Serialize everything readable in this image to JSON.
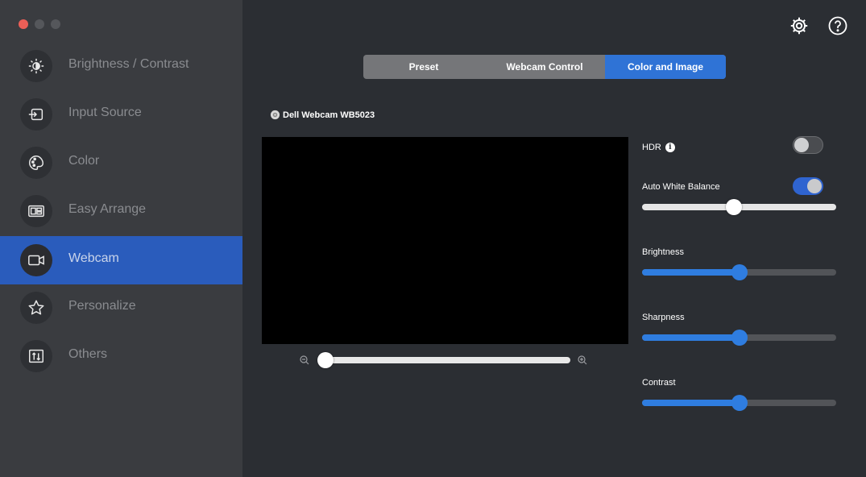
{
  "sidebar": {
    "items": [
      {
        "label": "Brightness / Contrast",
        "icon": "brightness-icon"
      },
      {
        "label": "Input Source",
        "icon": "input-source-icon"
      },
      {
        "label": "Color",
        "icon": "palette-icon"
      },
      {
        "label": "Easy Arrange",
        "icon": "layout-icon"
      },
      {
        "label": "Webcam",
        "icon": "webcam-icon",
        "active": true
      },
      {
        "label": "Personalize",
        "icon": "star-icon"
      },
      {
        "label": "Others",
        "icon": "others-icon"
      }
    ]
  },
  "tabs": [
    {
      "label": "Preset"
    },
    {
      "label": "Webcam Control"
    },
    {
      "label": "Color and Image",
      "active": true
    }
  ],
  "camera": {
    "name": "Dell Webcam WB5023"
  },
  "zoom": {
    "value": 0
  },
  "controls": {
    "hdr": {
      "label": "HDR",
      "enabled": false
    },
    "awb": {
      "label": "Auto White Balance",
      "enabled": true,
      "value": 0.47
    },
    "brightness": {
      "label": "Brightness",
      "value": 0.5
    },
    "sharpness": {
      "label": "Sharpness",
      "value": 0.5
    },
    "contrast": {
      "label": "Contrast",
      "value": 0.5
    }
  },
  "colors": {
    "accent": "#2f7de0",
    "active_nav": "#2a5cbc",
    "active_tab": "#2f73d6"
  }
}
